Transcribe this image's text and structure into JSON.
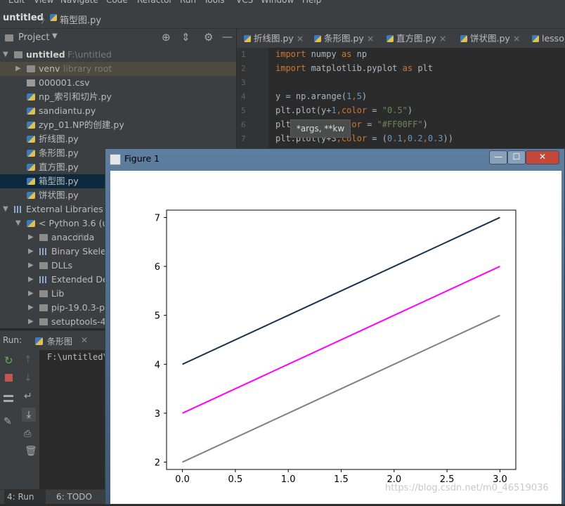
{
  "menu": [
    "Edit",
    "View",
    "Navigate",
    "Code",
    "Refactor",
    "Run",
    "Tools",
    "VCS",
    "Window",
    "Help"
  ],
  "breadcrumb": {
    "project": "untitled",
    "file": "箱型图.py"
  },
  "project_panel": {
    "title": "Project",
    "tree": [
      {
        "label": "untitled",
        "extra": "F:\\untitled",
        "type": "folder",
        "arrow": "▼",
        "level": 0,
        "bold": true
      },
      {
        "label": "venv",
        "extra": "library root",
        "type": "folder",
        "arrow": "▶",
        "level": 1,
        "style": "venv"
      },
      {
        "label": "000001.csv",
        "type": "file",
        "level": 1
      },
      {
        "label": "np_索引和切片.py",
        "type": "py",
        "level": 1
      },
      {
        "label": "sandiantu.py",
        "type": "py",
        "level": 1
      },
      {
        "label": "zyp_01.NP的创建.py",
        "type": "py",
        "level": 1
      },
      {
        "label": "折线图.py",
        "type": "py",
        "level": 1
      },
      {
        "label": "条形图.py",
        "type": "py",
        "level": 1
      },
      {
        "label": "直方图.py",
        "type": "py",
        "level": 1
      },
      {
        "label": "箱型图.py",
        "type": "py",
        "level": 1,
        "style": "sel"
      },
      {
        "label": "饼状图.py",
        "type": "py",
        "level": 1
      },
      {
        "label": "External Libraries",
        "type": "lib",
        "arrow": "▼",
        "level": 0
      },
      {
        "label": "< Python 3.6 (un",
        "type": "py",
        "arrow": "▼",
        "level": 1
      },
      {
        "label": "anaconda",
        "extra": "lib",
        "type": "folder",
        "arrow": "▶",
        "level": 2
      },
      {
        "label": "Binary Skelet",
        "type": "lib",
        "arrow": "▶",
        "level": 2
      },
      {
        "label": "DLLs",
        "type": "folder",
        "arrow": "▶",
        "level": 2
      },
      {
        "label": "Extended De",
        "type": "lib",
        "arrow": "▶",
        "level": 2
      },
      {
        "label": "Lib",
        "type": "folder",
        "arrow": "▶",
        "level": 2
      },
      {
        "label": "pip-19.0.3-py",
        "type": "folder",
        "arrow": "▶",
        "level": 2
      },
      {
        "label": "setuptools-40",
        "type": "folder",
        "arrow": "▶",
        "level": 2
      }
    ]
  },
  "editor_tabs": [
    "折线图.py",
    "条形图.py",
    "直方图.py",
    "饼状图.py",
    "lesso"
  ],
  "code": {
    "line_numbers": [
      "1",
      "2",
      "3",
      "4",
      "5",
      "6",
      "7"
    ],
    "lines": [
      [
        {
          "t": "import",
          "c": "kw"
        },
        {
          "t": " numpy ",
          "c": ""
        },
        {
          "t": "as",
          "c": "kw"
        },
        {
          "t": " np",
          "c": ""
        }
      ],
      [
        {
          "t": "import",
          "c": "kw"
        },
        {
          "t": " matplotlib.pyplot ",
          "c": ""
        },
        {
          "t": "as",
          "c": "kw"
        },
        {
          "t": " plt",
          "c": ""
        }
      ],
      [],
      [
        {
          "t": "y = np.arange(",
          "c": ""
        },
        {
          "t": "1",
          "c": "num"
        },
        {
          "t": ",",
          "c": "kw"
        },
        {
          "t": "5",
          "c": "num"
        },
        {
          "t": ")",
          "c": ""
        }
      ],
      [
        {
          "t": "plt.plot(y+",
          "c": ""
        },
        {
          "t": "1",
          "c": "num"
        },
        {
          "t": ",",
          "c": "kw"
        },
        {
          "t": "color",
          "c": "kw"
        },
        {
          "t": " = ",
          "c": ""
        },
        {
          "t": "\"0.5\"",
          "c": "str"
        },
        {
          "t": ")",
          "c": ""
        }
      ],
      [
        {
          "t": "plt",
          "c": ""
        },
        {
          "t": "         ",
          "c": ""
        },
        {
          "t": "color",
          "c": "kw"
        },
        {
          "t": " = ",
          "c": ""
        },
        {
          "t": "\"#FF00FF\"",
          "c": "str"
        },
        {
          "t": ")",
          "c": ""
        }
      ],
      [
        {
          "t": "plt.plot(y+3",
          "c": ""
        },
        {
          "t": ",",
          "c": "kw"
        },
        {
          "t": "color",
          "c": "kw"
        },
        {
          "t": " = ",
          "c": ""
        },
        {
          "t": "(",
          "c": ""
        },
        {
          "t": "0.1",
          "c": "num"
        },
        {
          "t": ",",
          "c": "kw"
        },
        {
          "t": "0.2",
          "c": "num"
        },
        {
          "t": ",",
          "c": "kw"
        },
        {
          "t": "0.3",
          "c": "num"
        },
        {
          "t": "))",
          "c": ""
        }
      ]
    ]
  },
  "tooltip": "*args, **kw",
  "run": {
    "label": "Run:",
    "tab": "条形图",
    "output": "F:\\untitled\\"
  },
  "status": {
    "run_tab": "4: Run",
    "todo_tab": "6: TODO"
  },
  "figure": {
    "title": "Figure 1"
  },
  "chart_data": {
    "type": "line",
    "x": [
      0,
      1,
      2,
      3
    ],
    "series": [
      {
        "values": [
          2,
          3,
          4,
          5
        ],
        "color": "#808080"
      },
      {
        "values": [
          3,
          4,
          5,
          6
        ],
        "color": "#FF00FF"
      },
      {
        "values": [
          4,
          5,
          6,
          7
        ],
        "color": "#1a334d"
      }
    ],
    "xlim": [
      -0.15,
      3.15
    ],
    "ylim": [
      1.85,
      7.15
    ],
    "xticks": [
      "0.0",
      "0.5",
      "1.0",
      "1.5",
      "2.0",
      "2.5",
      "3.0"
    ],
    "yticks": [
      "2",
      "3",
      "4",
      "5",
      "6",
      "7"
    ]
  },
  "watermark": "https://blog.csdn.net/m0_46519036"
}
